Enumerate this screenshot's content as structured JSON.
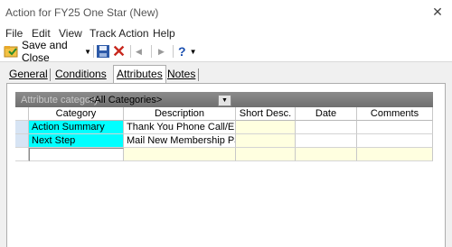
{
  "window": {
    "title": "Action for FY25 One Star (New)"
  },
  "menubar": {
    "items": [
      "File",
      "Edit",
      "View",
      "Track Action",
      "Help"
    ]
  },
  "toolbar": {
    "save_close_label": "Save and Close",
    "icons": [
      "save-close-icon",
      "floppy-disk-icon",
      "delete-icon",
      "previous-icon",
      "next-icon",
      "help-icon"
    ]
  },
  "tabs": [
    {
      "label": "General",
      "active": false
    },
    {
      "label": "Conditions",
      "active": false
    },
    {
      "label": "Attributes",
      "active": true
    },
    {
      "label": "Notes",
      "active": false
    }
  ],
  "attributes": {
    "category_label": "Attribute category:",
    "category_value": "<All Categories>",
    "columns": [
      "Category",
      "Description",
      "Short Desc.",
      "Date",
      "Comments"
    ],
    "rows": [
      {
        "category": "Action Summary",
        "description": "Thank You Phone Call/Ema…",
        "short_desc": "",
        "date": "",
        "comments": ""
      },
      {
        "category": "Next Step",
        "description": "Mail New Membership Packet",
        "short_desc": "",
        "date": "",
        "comments": ""
      }
    ]
  },
  "colors": {
    "category_cell": "#00ffff",
    "short_desc_cell": "#ffffe0",
    "row_selector": "#d7e4f4",
    "delete_icon": "#c8281e"
  }
}
